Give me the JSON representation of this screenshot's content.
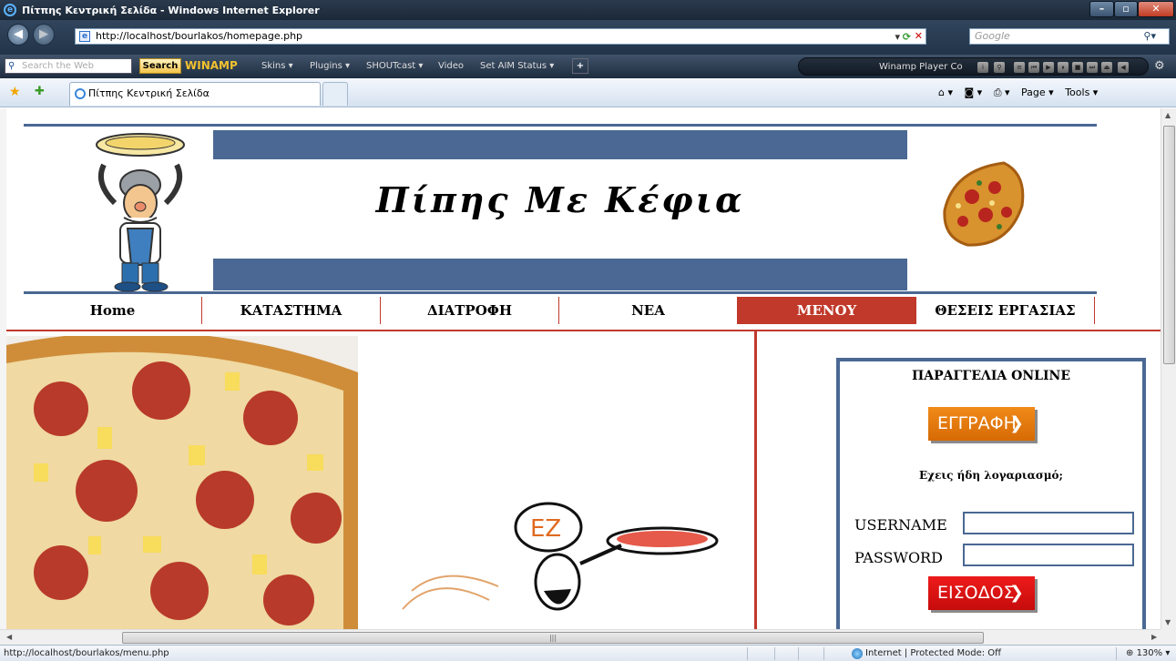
{
  "window": {
    "title": "Πίτπης Κεντρική Σελίδα - Windows Internet Explorer",
    "min": "–",
    "max": "▫",
    "close": "✕"
  },
  "address": {
    "url": "http://localhost/bourlakos/homepage.php",
    "search_placeholder": "Google"
  },
  "toolbar": {
    "search_placeholder": "Search the Web",
    "search_button": "Search",
    "winamp": "WINAMP",
    "items": [
      "Skins ▾",
      "Plugins ▾",
      "SHOUTcast ▾",
      "Video",
      "Set AIM Status ▾"
    ],
    "player_label": "Winamp Player Co"
  },
  "tabs": {
    "active_tab": "Πίτπης Κεντρική Σελίδα",
    "page_menu": "Page ▾",
    "tools_menu": "Tools ▾"
  },
  "site": {
    "title": "Πίπης Με Κέφια",
    "nav": [
      "Home",
      "ΚΑΤΑΣΤΗΜΑ",
      "ΔΙΑΤΡΟΦΗ",
      "ΝΕΑ",
      "ΜΕΝΟΥ",
      "ΘΕΣΕΙΣ ΕΡΓΑΣΙΑΣ"
    ],
    "active_nav": "ΜΕΝΟΥ",
    "order": {
      "title": "ΠΑΡΑΓΓΕΛΙΑ ONLINE",
      "register_button": "ΕΓΓΡΑΦΗ",
      "has_account": "Εχεις ήδη λογαριασμό;",
      "username_label": "USERNAME",
      "password_label": "PASSWORD",
      "username_value": "",
      "password_value": "",
      "login_button": "ΕΙΣΟΔΟΣ"
    },
    "chef_hat_text": "EZ"
  },
  "status": {
    "url": "http://localhost/bourlakos/menu.php",
    "zone": "Internet | Protected Mode: Off",
    "zoom": "130%"
  },
  "colors": {
    "accent_blue": "#4a6893",
    "accent_red": "#c0392b",
    "register_orange": "#e87b10",
    "login_red": "#e01414"
  }
}
